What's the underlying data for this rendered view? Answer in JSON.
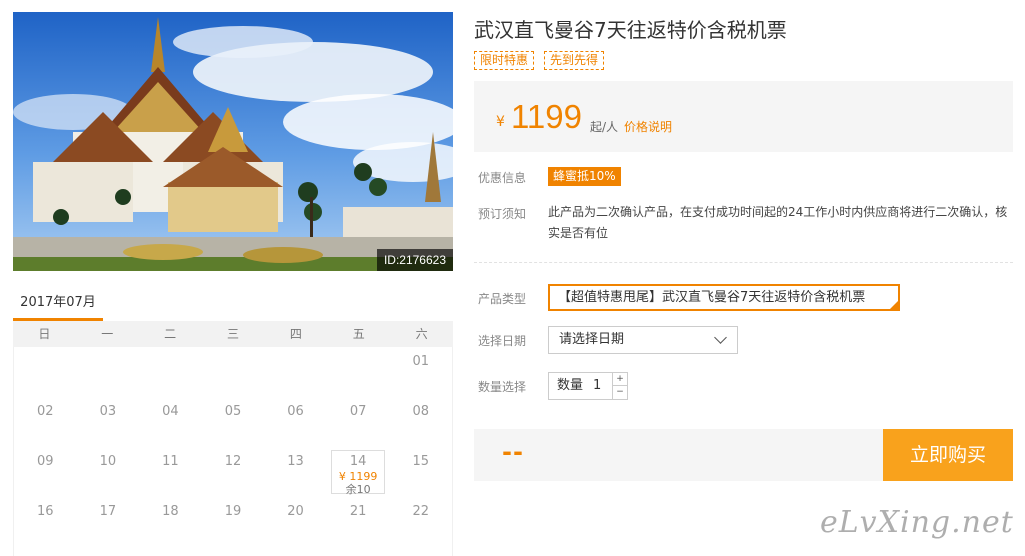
{
  "photo": {
    "id_label": "ID:2176623"
  },
  "calendar": {
    "month_tab": "2017年07月",
    "weekdays": [
      "日",
      "一",
      "二",
      "三",
      "四",
      "五",
      "六"
    ],
    "rows": [
      [
        "",
        "",
        "",
        "",
        "",
        "",
        "01"
      ],
      [
        "02",
        "03",
        "04",
        "05",
        "06",
        "07",
        "08"
      ],
      [
        "09",
        "10",
        "11",
        "12",
        "13",
        "14",
        "15"
      ],
      [
        "16",
        "17",
        "18",
        "19",
        "20",
        "21",
        "22"
      ]
    ],
    "available_day": {
      "day": "14",
      "price": "¥ 1199",
      "remaining": "余10"
    }
  },
  "product": {
    "title": "武汉直飞曼谷7天往返特价含税机票",
    "tags": [
      "限时特惠",
      "先到先得"
    ],
    "price": {
      "currency": "¥",
      "amount": "1199",
      "unit": "起/人",
      "explain_link": "价格说明"
    },
    "promo": {
      "label": "优惠信息",
      "badge": "蜂蜜抵10%"
    },
    "notice": {
      "label": "预订须知",
      "text": "此产品为二次确认产品，在支付成功时间起的24工作小时内供应商将进行二次确认，核实是否有位"
    },
    "type": {
      "label": "产品类型",
      "value": "【超值特惠甩尾】武汉直飞曼谷7天往返特价含税机票"
    },
    "date": {
      "label": "选择日期",
      "value": "请选择日期"
    },
    "quantity": {
      "label": "数量选择",
      "field_label": "数量",
      "value": "1",
      "inc": "+",
      "dec": "−"
    },
    "total_display": "--",
    "buy_button": "立即购买"
  },
  "watermark": "eLvXing.net",
  "colors": {
    "accent": "#f08300",
    "button": "#f9a21c"
  }
}
